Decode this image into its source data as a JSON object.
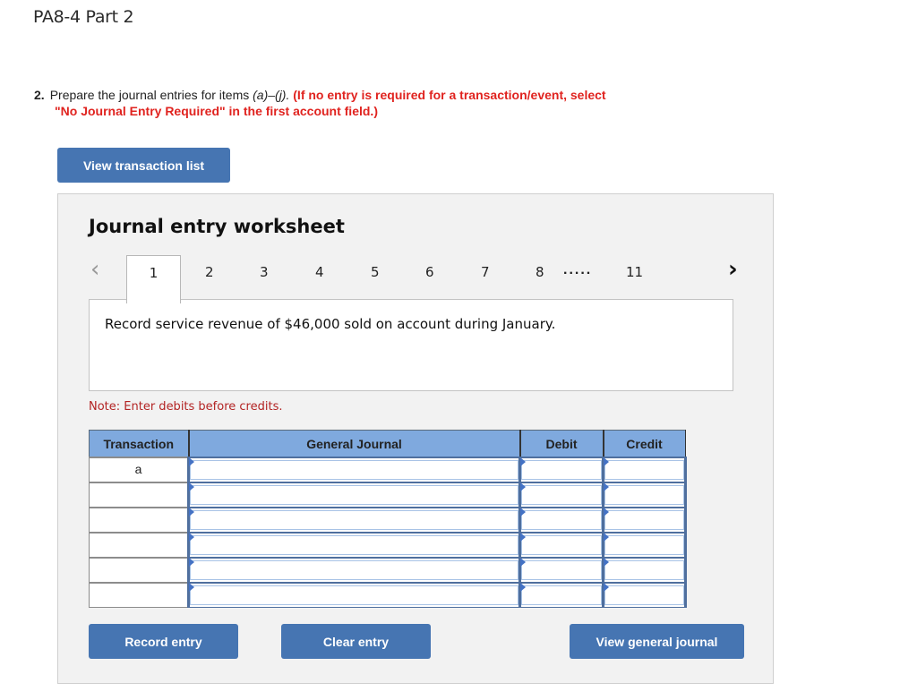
{
  "page": {
    "title": "PA8-4 Part 2"
  },
  "instructions": {
    "number": "2.",
    "text_plain": "Prepare the journal entries for items ",
    "items_range": "(a)–(j).",
    "text_red_line1": "(If no entry is required for a transaction/event, select",
    "text_red_line2": "\"No Journal Entry Required\" in the first account field.)"
  },
  "buttons": {
    "view_transaction_list": "View transaction list",
    "record_entry": "Record entry",
    "clear_entry": "Clear entry",
    "view_general_journal": "View general journal"
  },
  "worksheet": {
    "title": "Journal entry worksheet",
    "pager": {
      "prev_icon": "chevron-left-icon",
      "next_icon": "chevron-right-icon",
      "active": "1",
      "tabs": [
        "1",
        "2",
        "3",
        "4",
        "5",
        "6",
        "7",
        "8"
      ],
      "ellipsis": ".....",
      "last": "11"
    },
    "description": "Record service revenue of $46,000 sold on account during January.",
    "note": "Note: Enter debits before credits.",
    "table": {
      "headers": [
        "Transaction",
        "General Journal",
        "Debit",
        "Credit"
      ],
      "rows": [
        {
          "transaction": "a",
          "account": "",
          "debit": "",
          "credit": ""
        },
        {
          "transaction": "",
          "account": "",
          "debit": "",
          "credit": ""
        },
        {
          "transaction": "",
          "account": "",
          "debit": "",
          "credit": ""
        },
        {
          "transaction": "",
          "account": "",
          "debit": "",
          "credit": ""
        },
        {
          "transaction": "",
          "account": "",
          "debit": "",
          "credit": ""
        },
        {
          "transaction": "",
          "account": "",
          "debit": "",
          "credit": ""
        }
      ]
    }
  },
  "colors": {
    "button_blue": "#4675b2",
    "header_blue": "#7fa9de",
    "instruction_red": "#e0231f",
    "note_red": "#b32424"
  }
}
